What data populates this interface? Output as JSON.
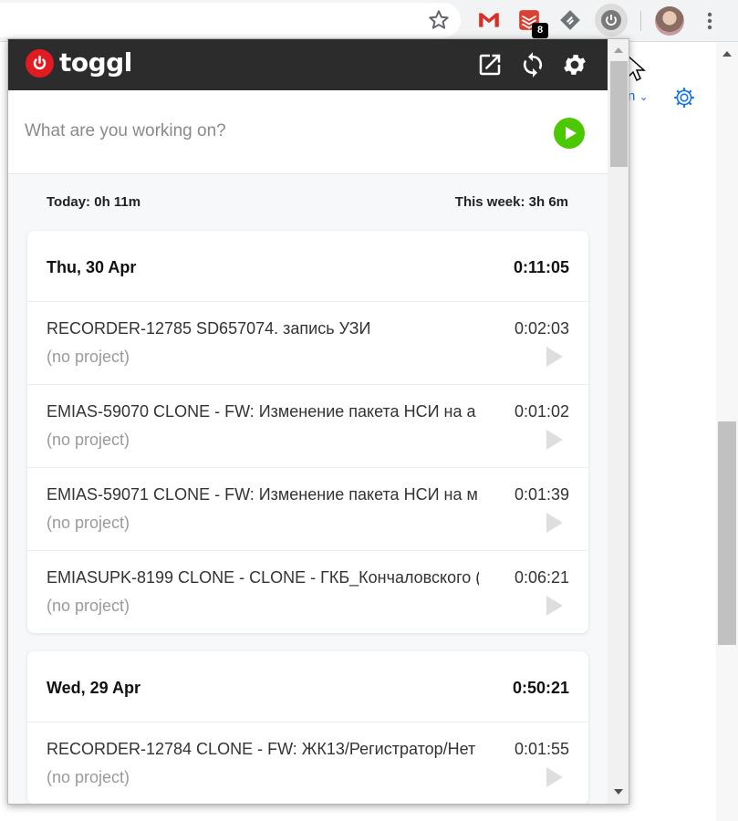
{
  "chrome": {
    "todoist_badge": "8"
  },
  "page": {
    "link_text": "n"
  },
  "popup": {
    "logo_text": "toggl",
    "entry_placeholder": "What are you working on?",
    "totals": {
      "today": "Today: 0h 11m",
      "week": "This week: 3h 6m"
    },
    "days": [
      {
        "title": "Thu, 30 Apr",
        "total": "0:11:05",
        "entries": [
          {
            "description": "RECORDER-12785 SD657074. запись УЗИ",
            "project": "(no project)",
            "duration": "0:02:03"
          },
          {
            "description": "EMIAS-59070 CLONE - FW: Изменение пакета НСИ на а",
            "project": "(no project)",
            "duration": "0:01:02"
          },
          {
            "description": "EMIAS-59071 CLONE - FW: Изменение пакета НСИ на м",
            "project": "(no project)",
            "duration": "0:01:39"
          },
          {
            "description": "EMIASUPK-8199 CLONE - CLONE - ГКБ_Кончаловского (",
            "project": "(no project)",
            "duration": "0:06:21"
          }
        ]
      },
      {
        "title": "Wed, 29 Apr",
        "total": "0:50:21",
        "entries": [
          {
            "description": "RECORDER-12784 CLONE - FW: ЖК13/Регистратор/Нет",
            "project": "(no project)",
            "duration": "0:01:55"
          }
        ]
      }
    ]
  },
  "colors": {
    "toggl_red": "#e01b22",
    "start_green": "#4bc800",
    "header_dark": "#2c2c2c"
  },
  "icons": [
    "star-icon",
    "gmail-icon",
    "todoist-icon",
    "feedly-icon",
    "toggl-power-icon",
    "open-external-icon",
    "sync-icon",
    "settings-gear-icon",
    "play-icon"
  ]
}
